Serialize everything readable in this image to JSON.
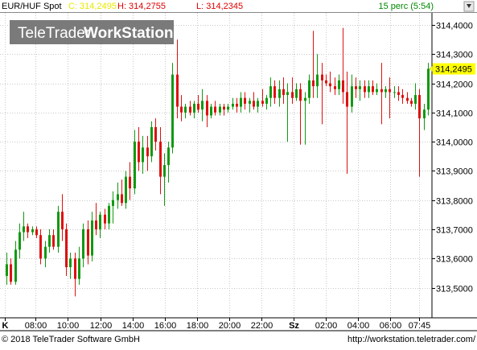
{
  "header": {
    "symbol": "EUR/HUF Spot",
    "close_label": "C: 314,2495",
    "high_label": "H: 314,2755",
    "low_label": "L: 314,2345",
    "interval": "15 perc (5:54)"
  },
  "watermark": {
    "text_light": "TeleTrader",
    "text_bold": "WorkStation"
  },
  "footer": {
    "copyright": "© 2018 TeleTrader Software GmbH",
    "url": "http://workstation.teletrader.com/"
  },
  "colors": {
    "up": "#119911",
    "down": "#dd1111",
    "grid": "#c8c8c8",
    "last_price_bg": "#ffff00",
    "close_text": "#e8e800",
    "high_low_text": "#dd0000",
    "interval_text": "#008800"
  },
  "chart_data": {
    "type": "candlestick",
    "title": "EUR/HUF Spot",
    "interval": "15 perc",
    "x_tick_labels": [
      "K",
      "08:00",
      "10:00",
      "12:00",
      "14:00",
      "16:00",
      "18:00",
      "20:00",
      "22:00",
      "Sz",
      "02:00",
      "04:00",
      "06:00",
      "07:45"
    ],
    "y_tick_labels": [
      "314,4000",
      "314,3000",
      "314,2000",
      "314,1000",
      "314,0000",
      "313,9000",
      "313,8000",
      "313,7000",
      "313,6000",
      "313,5000"
    ],
    "ylim": [
      313.41,
      314.46
    ],
    "last_price": 314.2495,
    "last_price_label": "314,2495",
    "grid": true,
    "series": [
      {
        "candles": [
          {
            "o": 313.54,
            "h": 313.62,
            "l": 313.51,
            "c": 313.58
          },
          {
            "o": 313.58,
            "h": 313.6,
            "l": 313.51,
            "c": 313.52
          },
          {
            "o": 313.52,
            "h": 313.66,
            "l": 313.51,
            "c": 313.63
          },
          {
            "o": 313.63,
            "h": 313.72,
            "l": 313.6,
            "c": 313.69
          },
          {
            "o": 313.69,
            "h": 313.76,
            "l": 313.66,
            "c": 313.71
          },
          {
            "o": 313.71,
            "h": 313.72,
            "l": 313.67,
            "c": 313.69
          },
          {
            "o": 313.69,
            "h": 313.71,
            "l": 313.68,
            "c": 313.7
          },
          {
            "o": 313.7,
            "h": 313.71,
            "l": 313.67,
            "c": 313.68
          },
          {
            "o": 313.68,
            "h": 313.7,
            "l": 313.58,
            "c": 313.6
          },
          {
            "o": 313.6,
            "h": 313.66,
            "l": 313.57,
            "c": 313.64
          },
          {
            "o": 313.64,
            "h": 313.7,
            "l": 313.62,
            "c": 313.68
          },
          {
            "o": 313.68,
            "h": 313.7,
            "l": 313.63,
            "c": 313.64
          },
          {
            "o": 313.64,
            "h": 313.78,
            "l": 313.62,
            "c": 313.76
          },
          {
            "o": 313.76,
            "h": 313.82,
            "l": 313.66,
            "c": 313.7
          },
          {
            "o": 313.7,
            "h": 313.72,
            "l": 313.54,
            "c": 313.57
          },
          {
            "o": 313.57,
            "h": 313.62,
            "l": 313.53,
            "c": 313.6
          },
          {
            "o": 313.6,
            "h": 313.62,
            "l": 313.47,
            "c": 313.53
          },
          {
            "o": 313.53,
            "h": 313.64,
            "l": 313.51,
            "c": 313.6
          },
          {
            "o": 313.6,
            "h": 313.72,
            "l": 313.57,
            "c": 313.7
          },
          {
            "o": 313.7,
            "h": 313.73,
            "l": 313.58,
            "c": 313.61
          },
          {
            "o": 313.61,
            "h": 313.76,
            "l": 313.59,
            "c": 313.73
          },
          {
            "o": 313.73,
            "h": 313.79,
            "l": 313.68,
            "c": 313.7
          },
          {
            "o": 313.7,
            "h": 313.76,
            "l": 313.67,
            "c": 313.75
          },
          {
            "o": 313.75,
            "h": 313.77,
            "l": 313.7,
            "c": 313.72
          },
          {
            "o": 313.72,
            "h": 313.79,
            "l": 313.7,
            "c": 313.78
          },
          {
            "o": 313.78,
            "h": 313.83,
            "l": 313.72,
            "c": 313.8
          },
          {
            "o": 313.8,
            "h": 313.86,
            "l": 313.77,
            "c": 313.82
          },
          {
            "o": 313.82,
            "h": 313.87,
            "l": 313.78,
            "c": 313.79
          },
          {
            "o": 313.79,
            "h": 313.9,
            "l": 313.77,
            "c": 313.88
          },
          {
            "o": 313.88,
            "h": 313.93,
            "l": 313.8,
            "c": 313.84
          },
          {
            "o": 313.84,
            "h": 314.04,
            "l": 313.82,
            "c": 314.0
          },
          {
            "o": 314.0,
            "h": 314.05,
            "l": 313.9,
            "c": 313.93
          },
          {
            "o": 313.93,
            "h": 314.02,
            "l": 313.89,
            "c": 313.98
          },
          {
            "o": 313.98,
            "h": 314.02,
            "l": 313.9,
            "c": 313.95
          },
          {
            "o": 313.95,
            "h": 314.07,
            "l": 313.93,
            "c": 314.05
          },
          {
            "o": 314.05,
            "h": 314.08,
            "l": 313.97,
            "c": 314.0
          },
          {
            "o": 314.0,
            "h": 314.05,
            "l": 313.82,
            "c": 313.88
          },
          {
            "o": 313.88,
            "h": 313.96,
            "l": 313.78,
            "c": 313.92
          },
          {
            "o": 313.92,
            "h": 314.0,
            "l": 313.86,
            "c": 313.98
          },
          {
            "o": 313.98,
            "h": 314.27,
            "l": 313.96,
            "c": 314.23
          },
          {
            "o": 314.23,
            "h": 314.35,
            "l": 314.08,
            "c": 314.12
          },
          {
            "o": 314.12,
            "h": 314.16,
            "l": 314.07,
            "c": 314.1
          },
          {
            "o": 314.1,
            "h": 314.13,
            "l": 314.08,
            "c": 314.12
          },
          {
            "o": 314.12,
            "h": 314.14,
            "l": 314.09,
            "c": 314.1
          },
          {
            "o": 314.1,
            "h": 314.14,
            "l": 314.08,
            "c": 314.13
          },
          {
            "o": 314.13,
            "h": 314.16,
            "l": 314.1,
            "c": 314.11
          },
          {
            "o": 314.11,
            "h": 314.18,
            "l": 314.07,
            "c": 314.14
          },
          {
            "o": 314.14,
            "h": 314.16,
            "l": 314.05,
            "c": 314.09
          },
          {
            "o": 314.09,
            "h": 314.13,
            "l": 314.08,
            "c": 314.12
          },
          {
            "o": 314.12,
            "h": 314.14,
            "l": 314.09,
            "c": 314.1
          },
          {
            "o": 314.1,
            "h": 314.13,
            "l": 314.09,
            "c": 314.12
          },
          {
            "o": 314.12,
            "h": 314.13,
            "l": 314.09,
            "c": 314.11
          },
          {
            "o": 314.11,
            "h": 314.13,
            "l": 314.1,
            "c": 314.12
          },
          {
            "o": 314.12,
            "h": 314.15,
            "l": 314.11,
            "c": 314.13
          },
          {
            "o": 314.13,
            "h": 314.15,
            "l": 314.1,
            "c": 314.12
          },
          {
            "o": 314.12,
            "h": 314.17,
            "l": 314.1,
            "c": 314.15
          },
          {
            "o": 314.15,
            "h": 314.17,
            "l": 314.11,
            "c": 314.13
          },
          {
            "o": 314.13,
            "h": 314.15,
            "l": 314.1,
            "c": 314.14
          },
          {
            "o": 314.14,
            "h": 314.17,
            "l": 314.11,
            "c": 314.12
          },
          {
            "o": 314.12,
            "h": 314.15,
            "l": 314.1,
            "c": 314.14
          },
          {
            "o": 314.14,
            "h": 314.18,
            "l": 314.12,
            "c": 314.13
          },
          {
            "o": 314.13,
            "h": 314.16,
            "l": 314.11,
            "c": 314.15
          },
          {
            "o": 314.15,
            "h": 314.22,
            "l": 314.12,
            "c": 314.19
          },
          {
            "o": 314.19,
            "h": 314.21,
            "l": 314.13,
            "c": 314.15
          },
          {
            "o": 314.15,
            "h": 314.21,
            "l": 314.12,
            "c": 314.18
          },
          {
            "o": 314.18,
            "h": 314.22,
            "l": 314.13,
            "c": 314.16
          },
          {
            "o": 314.16,
            "h": 314.2,
            "l": 314.0,
            "c": 314.17
          },
          {
            "o": 314.17,
            "h": 314.22,
            "l": 314.13,
            "c": 314.15
          },
          {
            "o": 314.15,
            "h": 314.2,
            "l": 314.14,
            "c": 314.18
          },
          {
            "o": 314.18,
            "h": 314.2,
            "l": 313.99,
            "c": 314.14
          },
          {
            "o": 314.14,
            "h": 314.17,
            "l": 313.99,
            "c": 314.15
          },
          {
            "o": 314.15,
            "h": 314.23,
            "l": 314.13,
            "c": 314.21
          },
          {
            "o": 314.21,
            "h": 314.38,
            "l": 314.15,
            "c": 314.19
          },
          {
            "o": 314.19,
            "h": 314.3,
            "l": 314.15,
            "c": 314.23
          },
          {
            "o": 314.23,
            "h": 314.27,
            "l": 314.06,
            "c": 314.21
          },
          {
            "o": 314.21,
            "h": 314.23,
            "l": 314.19,
            "c": 314.2
          },
          {
            "o": 314.2,
            "h": 314.24,
            "l": 314.17,
            "c": 314.19
          },
          {
            "o": 314.19,
            "h": 314.22,
            "l": 314.16,
            "c": 314.18
          },
          {
            "o": 314.18,
            "h": 314.23,
            "l": 314.16,
            "c": 314.21
          },
          {
            "o": 314.21,
            "h": 314.39,
            "l": 314.13,
            "c": 314.17
          },
          {
            "o": 314.17,
            "h": 314.24,
            "l": 313.89,
            "c": 314.12
          },
          {
            "o": 314.12,
            "h": 314.23,
            "l": 314.1,
            "c": 314.19
          },
          {
            "o": 314.19,
            "h": 314.22,
            "l": 314.15,
            "c": 314.18
          },
          {
            "o": 314.18,
            "h": 314.21,
            "l": 314.14,
            "c": 314.19
          },
          {
            "o": 314.19,
            "h": 314.21,
            "l": 314.15,
            "c": 314.17
          },
          {
            "o": 314.17,
            "h": 314.21,
            "l": 314.15,
            "c": 314.19
          },
          {
            "o": 314.19,
            "h": 314.21,
            "l": 314.16,
            "c": 314.17
          },
          {
            "o": 314.17,
            "h": 314.2,
            "l": 314.16,
            "c": 314.18
          },
          {
            "o": 314.18,
            "h": 314.27,
            "l": 314.06,
            "c": 314.17
          },
          {
            "o": 314.17,
            "h": 314.19,
            "l": 314.15,
            "c": 314.18
          },
          {
            "o": 314.18,
            "h": 314.22,
            "l": 314.08,
            "c": 314.17
          },
          {
            "o": 314.17,
            "h": 314.19,
            "l": 314.15,
            "c": 314.17
          },
          {
            "o": 314.17,
            "h": 314.19,
            "l": 314.14,
            "c": 314.16
          },
          {
            "o": 314.16,
            "h": 314.18,
            "l": 314.13,
            "c": 314.15
          },
          {
            "o": 314.15,
            "h": 314.17,
            "l": 314.13,
            "c": 314.14
          },
          {
            "o": 314.14,
            "h": 314.15,
            "l": 314.12,
            "c": 314.13
          },
          {
            "o": 314.13,
            "h": 314.2,
            "l": 314.11,
            "c": 314.16
          },
          {
            "o": 314.16,
            "h": 314.18,
            "l": 313.88,
            "c": 314.08
          },
          {
            "o": 314.08,
            "h": 314.13,
            "l": 314.04,
            "c": 314.11
          },
          {
            "o": 314.11,
            "h": 314.27,
            "l": 314.09,
            "c": 314.25
          }
        ]
      }
    ]
  }
}
